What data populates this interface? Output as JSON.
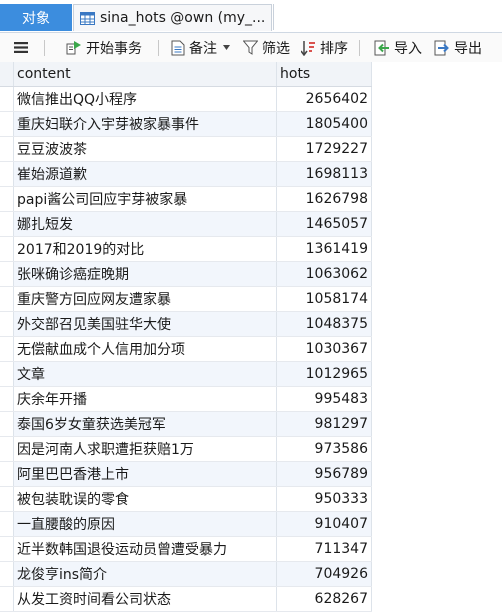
{
  "tabs": {
    "objects_label": "对象",
    "table_tab_label": "sina_hots @own (my_..."
  },
  "toolbar": {
    "begin_transaction": "开始事务",
    "note": "备注",
    "filter": "筛选",
    "sort": "排序",
    "import": "导入",
    "export": "导出"
  },
  "columns": [
    "content",
    "hots"
  ],
  "rows": [
    {
      "content": "微信推出QQ小程序",
      "hots": "2656402"
    },
    {
      "content": "重庆妇联介入宇芽被家暴事件",
      "hots": "1805400"
    },
    {
      "content": "豆豆波波茶",
      "hots": "1729227"
    },
    {
      "content": "崔始源道歉",
      "hots": "1698113"
    },
    {
      "content": "papi酱公司回应宇芽被家暴",
      "hots": "1626798"
    },
    {
      "content": "娜扎短发",
      "hots": "1465057"
    },
    {
      "content": "2017和2019的对比",
      "hots": "1361419"
    },
    {
      "content": "张咪确诊癌症晚期",
      "hots": "1063062"
    },
    {
      "content": "重庆警方回应网友遭家暴",
      "hots": "1058174"
    },
    {
      "content": "外交部召见美国驻华大使",
      "hots": "1048375"
    },
    {
      "content": "无偿献血成个人信用加分项",
      "hots": "1030367"
    },
    {
      "content": "文章",
      "hots": "1012965"
    },
    {
      "content": "庆余年开播",
      "hots": "995483"
    },
    {
      "content": "泰国6岁女童获选美冠军",
      "hots": "981297"
    },
    {
      "content": "因是河南人求职遭拒获赔1万",
      "hots": "973586"
    },
    {
      "content": "阿里巴巴香港上市",
      "hots": "956789"
    },
    {
      "content": "被包装耽误的零食",
      "hots": "950333"
    },
    {
      "content": "一直腰酸的原因",
      "hots": "910407"
    },
    {
      "content": "近半数韩国退役运动员曾遭受暴力",
      "hots": "711347"
    },
    {
      "content": "龙俊亨ins简介",
      "hots": "704926"
    },
    {
      "content": "从发工资时间看公司状态",
      "hots": "628267"
    }
  ]
}
